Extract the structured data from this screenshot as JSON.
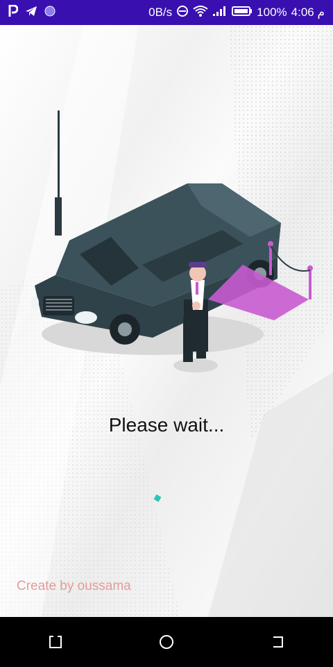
{
  "status_bar": {
    "speed": "0B/s",
    "battery": "100%",
    "time": "4:06 م",
    "icons": [
      "parking-icon",
      "telegram-icon",
      "circle-app-icon",
      "dnd-icon",
      "wifi-icon",
      "signal-icon",
      "battery-icon"
    ]
  },
  "main": {
    "loading_text": "Please wait...",
    "credit_text": "Create by oussama"
  },
  "nav_bar": {
    "buttons": [
      "back-button",
      "home-button",
      "recents-button"
    ]
  },
  "colors": {
    "status_bar": "#3a0fb0",
    "spinner": "#27c9b4",
    "credit": "#e79a9a",
    "carpet": "#c85bd0",
    "car_body": "#34474f"
  }
}
